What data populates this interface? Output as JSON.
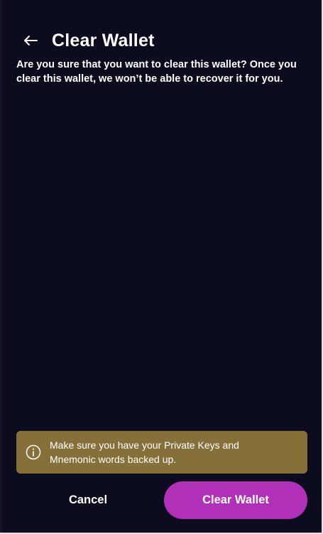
{
  "header": {
    "title": "Clear Wallet",
    "back_icon": "arrow-left-icon"
  },
  "message": "Are you sure that you want to clear this wallet? Once you clear this wallet, we won’t be able to recover it for you.",
  "warning": {
    "icon": "info-icon",
    "text": "Make sure you have your Private Keys and Mnemonic words backed up.",
    "background_color": "#86703a"
  },
  "actions": {
    "cancel_label": "Cancel",
    "confirm_label": "Clear Wallet",
    "confirm_color": "#b030b8"
  },
  "colors": {
    "background": "#0b0c1e",
    "text": "#ffffff"
  }
}
